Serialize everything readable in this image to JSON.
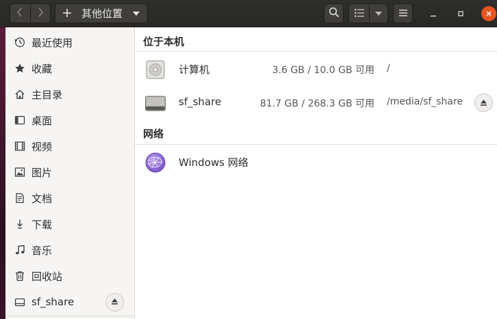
{
  "header": {
    "back_icon": "chevron-left-icon",
    "forward_icon": "chevron-right-icon",
    "path_label": "其他位置",
    "new_icon": "plus-icon",
    "search_icon": "search-icon",
    "view_icon": "list-view-icon",
    "menu_icon": "hamburger-icon",
    "accent": "#e95420"
  },
  "sidebar": {
    "items": [
      {
        "label": "最近使用",
        "icon": "clock-icon"
      },
      {
        "label": "收藏",
        "icon": "star-icon"
      },
      {
        "label": "主目录",
        "icon": "home-icon"
      },
      {
        "label": "桌面",
        "icon": "desktop-icon"
      },
      {
        "label": "视频",
        "icon": "film-icon"
      },
      {
        "label": "图片",
        "icon": "image-icon"
      },
      {
        "label": "文档",
        "icon": "document-icon"
      },
      {
        "label": "下载",
        "icon": "download-icon"
      },
      {
        "label": "音乐",
        "icon": "music-icon"
      },
      {
        "label": "回收站",
        "icon": "trash-icon"
      },
      {
        "label": "sf_share",
        "icon": "drive-icon"
      }
    ]
  },
  "main": {
    "sections": [
      {
        "title": "位于本机",
        "rows": [
          {
            "name": "计算机",
            "size": "3.6 GB / 10.0 GB 可用",
            "path": "/",
            "icon": "computer-disk-icon"
          },
          {
            "name": "sf_share",
            "size": "81.7 GB / 268.3 GB 可用",
            "path": "/media/sf_share",
            "icon": "drive-icon"
          }
        ]
      },
      {
        "title": "网络",
        "rows": [
          {
            "name": "Windows 网络",
            "icon": "network-globe-icon"
          }
        ]
      }
    ]
  }
}
